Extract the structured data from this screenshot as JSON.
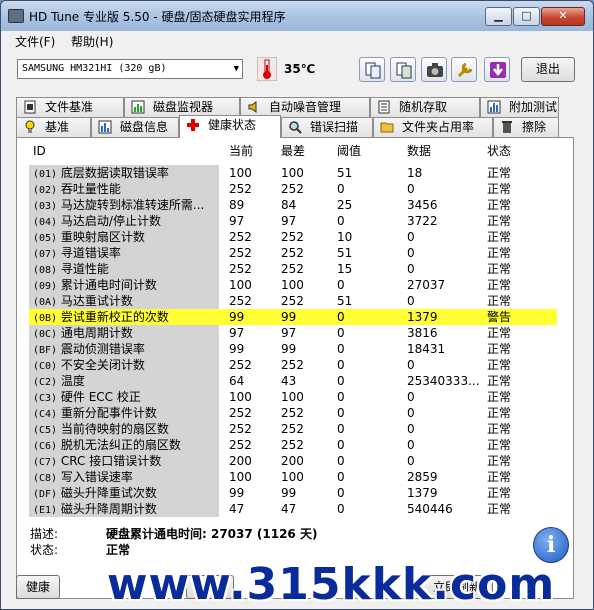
{
  "window": {
    "title": "HD Tune 专业版 5.50 - 硬盘/固态硬盘实用程序"
  },
  "menu": {
    "file": "文件(F)",
    "help": "帮助(H)"
  },
  "toolbar": {
    "drive": "SAMSUNG HM321HI (320 gB)",
    "temperature": "35℃",
    "exit_label": "退出"
  },
  "tabs_top": [
    {
      "label": "文件基准",
      "icon": "file-benchmark-icon"
    },
    {
      "label": "磁盘监视器",
      "icon": "disk-monitor-icon"
    },
    {
      "label": "自动噪音管理",
      "icon": "speaker-icon"
    },
    {
      "label": "随机存取",
      "icon": "random-access-icon"
    },
    {
      "label": "附加测试",
      "icon": "extra-tests-icon"
    }
  ],
  "tabs_bottom": [
    {
      "label": "基准",
      "icon": "lightbulb-icon"
    },
    {
      "label": "磁盘信息",
      "icon": "disk-info-icon"
    },
    {
      "label": "健康状态",
      "icon": "red-cross-icon"
    },
    {
      "label": "错误扫描",
      "icon": "magnifier-icon"
    },
    {
      "label": "文件夹占用率",
      "icon": "folder-icon"
    },
    {
      "label": "擦除",
      "icon": "trash-icon"
    }
  ],
  "columns": [
    "ID",
    "当前",
    "最差",
    "阈值",
    "数据",
    "状态"
  ],
  "rows": [
    [
      "(01) 底层数据读取错误率",
      "100",
      "100",
      "51",
      "18",
      "正常"
    ],
    [
      "(02) 吞吐量性能",
      "252",
      "252",
      "0",
      "0",
      "正常"
    ],
    [
      "(03) 马达旋转到标准转速所需...",
      "89",
      "84",
      "25",
      "3456",
      "正常"
    ],
    [
      "(04) 马达启动/停止计数",
      "97",
      "97",
      "0",
      "3722",
      "正常"
    ],
    [
      "(05) 重映射扇区计数",
      "252",
      "252",
      "10",
      "0",
      "正常"
    ],
    [
      "(07) 寻道错误率",
      "252",
      "252",
      "51",
      "0",
      "正常"
    ],
    [
      "(08) 寻道性能",
      "252",
      "252",
      "15",
      "0",
      "正常"
    ],
    [
      "(09) 累计通电时间计数",
      "100",
      "100",
      "0",
      "27037",
      "正常"
    ],
    [
      "(0A) 马达重试计数",
      "252",
      "252",
      "51",
      "0",
      "正常"
    ],
    [
      "(0B) 尝试重新校正的次数",
      "99",
      "99",
      "0",
      "1379",
      "警告"
    ],
    [
      "(0C) 通电周期计数",
      "97",
      "97",
      "0",
      "3816",
      "正常"
    ],
    [
      "(BF) 震动侦测错误率",
      "99",
      "99",
      "0",
      "18431",
      "正常"
    ],
    [
      "(C0) 不安全关闭计数",
      "252",
      "252",
      "0",
      "0",
      "正常"
    ],
    [
      "(C2) 温度",
      "64",
      "43",
      "0",
      "25340333...",
      "正常"
    ],
    [
      "(C3) 硬件 ECC 校正",
      "100",
      "100",
      "0",
      "0",
      "正常"
    ],
    [
      "(C4) 重新分配事件计数",
      "252",
      "252",
      "0",
      "0",
      "正常"
    ],
    [
      "(C5) 当前待映射的扇区数",
      "252",
      "252",
      "0",
      "0",
      "正常"
    ],
    [
      "(C6) 脱机无法纠正的扇区数",
      "252",
      "252",
      "0",
      "0",
      "正常"
    ],
    [
      "(C7) CRC 接口错误计数",
      "200",
      "200",
      "0",
      "0",
      "正常"
    ],
    [
      "(C8) 写入错误速率",
      "100",
      "100",
      "0",
      "2859",
      "正常"
    ],
    [
      "(DF) 磁头升降重试次数",
      "99",
      "99",
      "0",
      "1379",
      "正常"
    ],
    [
      "(E1) 磁头升降周期计数",
      "47",
      "47",
      "0",
      "540446",
      "正常"
    ]
  ],
  "warn_row": 9,
  "details": {
    "desc_label": "描述:",
    "desc_value": "硬盘累计通电时间: 27037 (1126 天)",
    "status_label": "状态:",
    "status_value": "正常"
  },
  "bottom": {
    "left_btn": "健康",
    "mid_btn": "刷新",
    "right_btn": "立即刷新"
  },
  "watermark": "www.315kkk.com",
  "colors": {
    "warn_bg": "#ffff33",
    "name_bg": "#d4d4d4"
  }
}
